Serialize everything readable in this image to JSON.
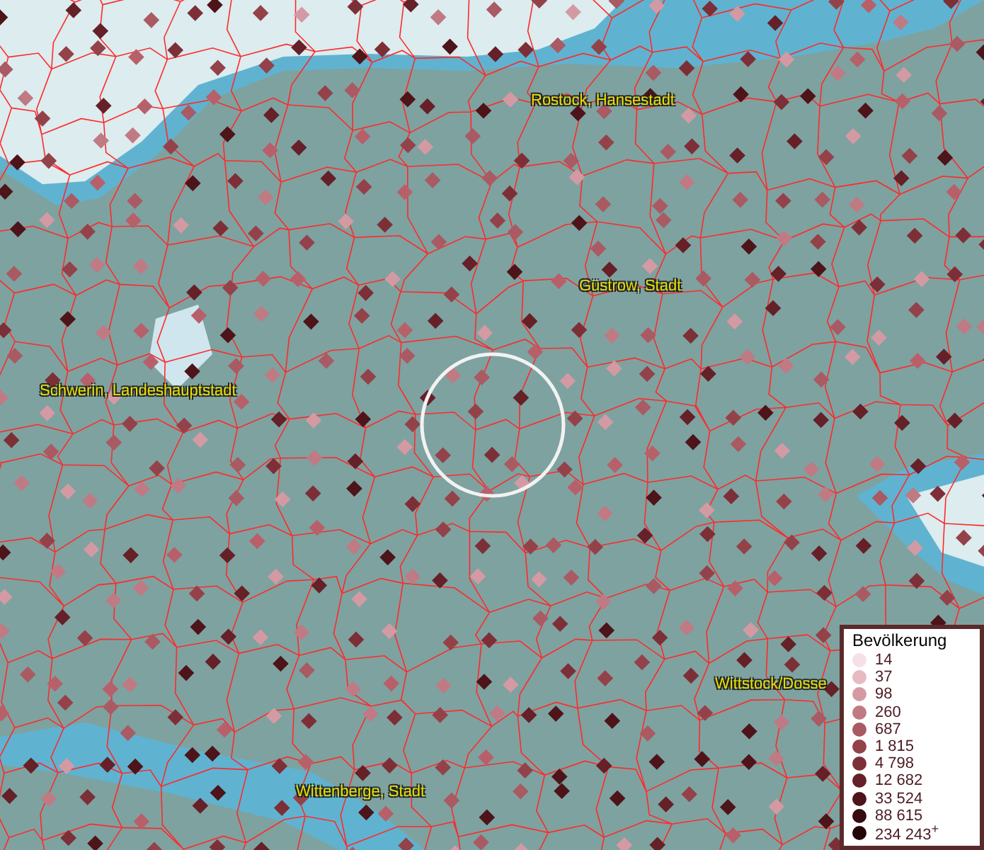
{
  "map": {
    "places": [
      {
        "name": "Rostock, Hansestadt"
      },
      {
        "name": "Güstrow, Stadt"
      },
      {
        "name": "Schwerin, Landeshauptstadt"
      },
      {
        "name": "Wittstock/Dosse"
      },
      {
        "name": "Wittenberge, Stadt"
      }
    ]
  },
  "legend": {
    "title": "Bevölkerung",
    "items": [
      {
        "label": "14",
        "color": "#f7dfe9"
      },
      {
        "label": "37",
        "color": "#e6b9c3"
      },
      {
        "label": "98",
        "color": "#d49aa3"
      },
      {
        "label": "260",
        "color": "#c07a83"
      },
      {
        "label": "687",
        "color": "#a95a63"
      },
      {
        "label": "1 815",
        "color": "#94424a"
      },
      {
        "label": "4 798",
        "color": "#7d2f37"
      },
      {
        "label": "12 682",
        "color": "#652028"
      },
      {
        "label": "33 524",
        "color": "#4d141a"
      },
      {
        "label": "88 615",
        "color": "#380b10"
      },
      {
        "label": "234 243$^{+}$",
        "color": "#240508"
      }
    ]
  }
}
